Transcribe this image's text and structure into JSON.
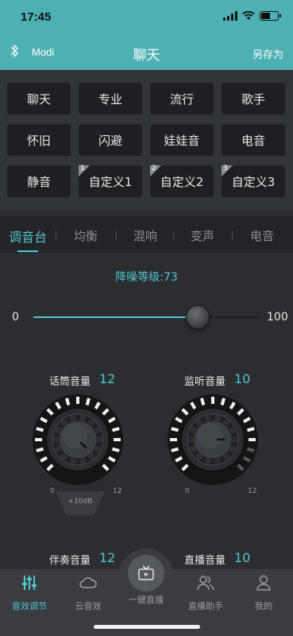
{
  "status_bar": {
    "time": "17:45"
  },
  "nav": {
    "device_name": "Modi",
    "title": "聊天",
    "save_as": "另存为"
  },
  "presets": [
    {
      "label": "聊天"
    },
    {
      "label": "专业"
    },
    {
      "label": "流行"
    },
    {
      "label": "歌手"
    },
    {
      "label": "怀旧"
    },
    {
      "label": "闪避"
    },
    {
      "label": "娃娃音"
    },
    {
      "label": "电音"
    },
    {
      "label": "静音"
    },
    {
      "label": "自定义1",
      "badge": "1"
    },
    {
      "label": "自定义2",
      "badge": "2"
    },
    {
      "label": "自定义3",
      "badge": "3"
    }
  ],
  "tabs": [
    "调音台",
    "均衡",
    "混响",
    "变声",
    "电音"
  ],
  "noise": {
    "label": "降噪等级:73",
    "value": 73,
    "min": "0",
    "max": "100"
  },
  "knobs": [
    {
      "label": "话筒音量",
      "value": "12",
      "min": "0",
      "max": "12",
      "boost": "+10dB",
      "level": 1.0
    },
    {
      "label": "监听音量",
      "value": "10",
      "min": "0",
      "max": "12",
      "level": 0.83
    }
  ],
  "bottom_controls": [
    {
      "label": "伴奏音量",
      "value": "12"
    },
    {
      "label": "直播音量",
      "value": "10"
    }
  ],
  "tabbar": {
    "items": [
      "音效调节",
      "云音效",
      "一键直播",
      "直播助手",
      "我的"
    ]
  },
  "colors": {
    "accent": "#52c6cc",
    "header": "#4fb0b3",
    "background": "#2b2d31"
  }
}
